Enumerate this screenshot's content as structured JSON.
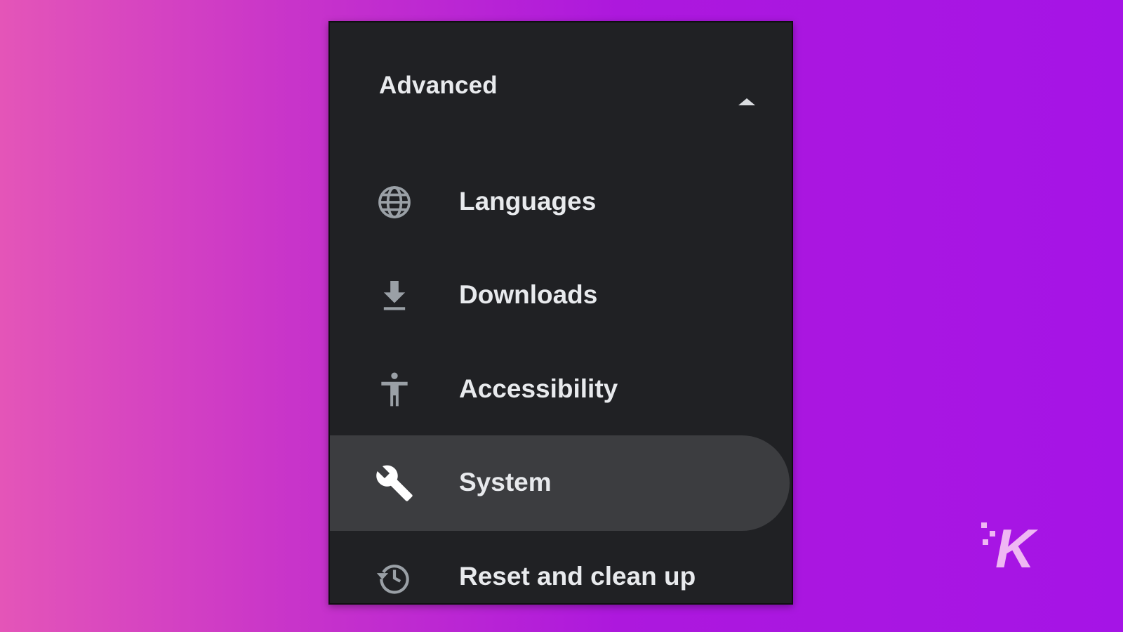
{
  "settings_menu": {
    "section_title": "Advanced",
    "section_state_icon": "chevron-up-icon",
    "items": [
      {
        "label": "Languages",
        "icon": "globe-icon",
        "selected": false
      },
      {
        "label": "Downloads",
        "icon": "download-icon",
        "selected": false
      },
      {
        "label": "Accessibility",
        "icon": "accessibility-icon",
        "selected": false
      },
      {
        "label": "System",
        "icon": "wrench-icon",
        "selected": true
      },
      {
        "label": "Reset and clean up",
        "icon": "restore-icon",
        "selected": false
      }
    ]
  },
  "watermark": {
    "logo": "K",
    "logo_icon": "knowtechie-logo-icon"
  },
  "colors": {
    "panel_background": "#202124",
    "selected_item_background": "#3c3d40",
    "text": "#e8eaed",
    "icon": "#9aa0a6",
    "selected_icon": "#ffffff",
    "background_gradient_start": "#e455b8",
    "background_gradient_end": "#a514e6",
    "logo": "#efb7f3"
  }
}
